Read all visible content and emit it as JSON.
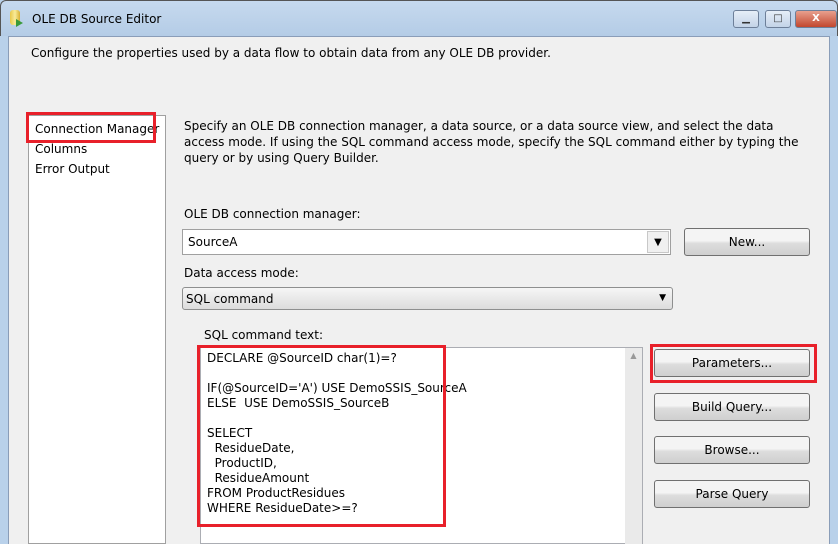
{
  "window": {
    "title": "OLE DB Source Editor",
    "minimize": "▁",
    "maximize": "□",
    "close": "X"
  },
  "description": "Configure the properties used by a data flow to obtain data from any OLE DB provider.",
  "nav": {
    "items": [
      "Connection Manager",
      "Columns",
      "Error Output"
    ]
  },
  "main": {
    "info": "Specify an OLE DB connection manager, a data source, or a data source view, and select the data access mode. If using the SQL command access mode, specify the SQL command either by typing the query or by using Query Builder.",
    "connection_label": "OLE DB connection manager:",
    "connection_value": "SourceA",
    "new_button": "New...",
    "access_label": "Data access mode:",
    "access_value": "SQL command",
    "sql_label": "SQL command text:",
    "sql_text": "DECLARE @SourceID char(1)=?\n\nIF(@SourceID='A') USE DemoSSIS_SourceA\nELSE  USE DemoSSIS_SourceB\n\nSELECT\n  ResidueDate,\n  ProductID,\n  ResidueAmount\nFROM ProductResidues\nWHERE ResidueDate>=?",
    "buttons": {
      "parameters": "Parameters...",
      "build_query": "Build Query...",
      "browse": "Browse...",
      "parse_query": "Parse Query"
    }
  },
  "colors": {
    "highlight": "#e8202a"
  }
}
